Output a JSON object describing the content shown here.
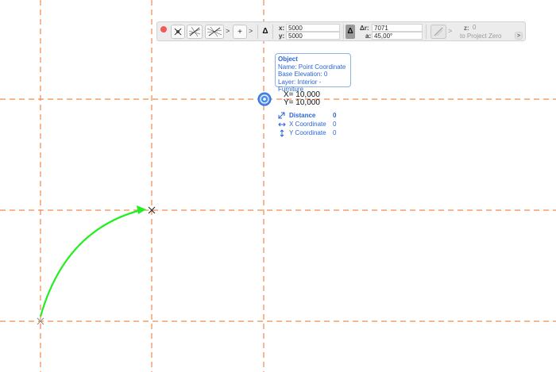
{
  "toolbar": {
    "x_label": "x:",
    "x_value": "5000",
    "y_label": "y:",
    "y_value": "5000",
    "dr_label": "Δr:",
    "dr_value": "7071",
    "a_label": "a:",
    "a_value": "45,00°",
    "z_label": "z:",
    "z_value": "0",
    "project_zero_label": "to Project Zero",
    "delta_symbol": "Δ",
    "plus_symbol": "+",
    "chevron": ">"
  },
  "object_tooltip": {
    "title": "Object",
    "name": "Name: Point Coordinate",
    "base_elevation": "Base Elevation: 0",
    "layer": "Layer: Interior - Furniture"
  },
  "coordinate_readout": {
    "x": "X= 10,000",
    "y": "Y= 10,000"
  },
  "measurements": [
    {
      "label": "Distance",
      "value": "0",
      "icon": "diagonal-arrow-icon"
    },
    {
      "label": "X Coordinate",
      "value": "0",
      "icon": "horizontal-arrow-icon"
    },
    {
      "label": "Y Coordinate",
      "value": "0",
      "icon": "vertical-arrow-icon"
    }
  ],
  "colors": {
    "grid_line": "#f08a4b",
    "arrow": "#22ee22",
    "accent_blue": "#2a66d6",
    "close_button": "#f25a57"
  }
}
